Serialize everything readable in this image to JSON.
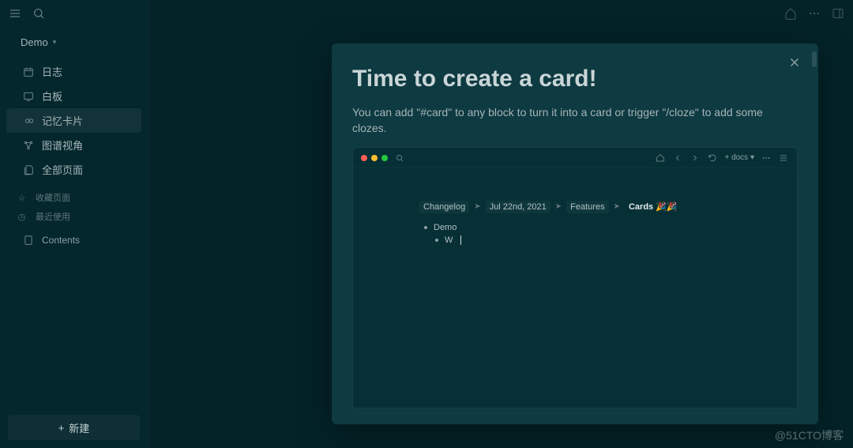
{
  "workspace": {
    "name": "Demo"
  },
  "sidebar": {
    "items": [
      {
        "label": "日志",
        "icon": "calendar-icon"
      },
      {
        "label": "白板",
        "icon": "whiteboard-icon"
      },
      {
        "label": "记忆卡片",
        "icon": "infinity-icon",
        "active": true
      },
      {
        "label": "图谱视角",
        "icon": "graph-icon"
      },
      {
        "label": "全部页面",
        "icon": "pages-icon"
      }
    ],
    "favorites_label": "收藏页面",
    "recent_label": "最近使用",
    "contents_label": "Contents",
    "new_label": "新建"
  },
  "modal": {
    "title": "Time to create a card!",
    "subtitle": "You can add \"#card\" to any block to turn it into a card or trigger \"/cloze\" to add some clozes."
  },
  "demo": {
    "docs_label": "docs",
    "breadcrumb": {
      "seg1": "Changelog",
      "seg2": "Jul 22nd, 2021",
      "seg3": "Features",
      "seg4": "Cards 🎉🎉"
    },
    "bullets": {
      "b1": "Demo",
      "b2": "W"
    }
  },
  "watermark": "@51CTO博客"
}
